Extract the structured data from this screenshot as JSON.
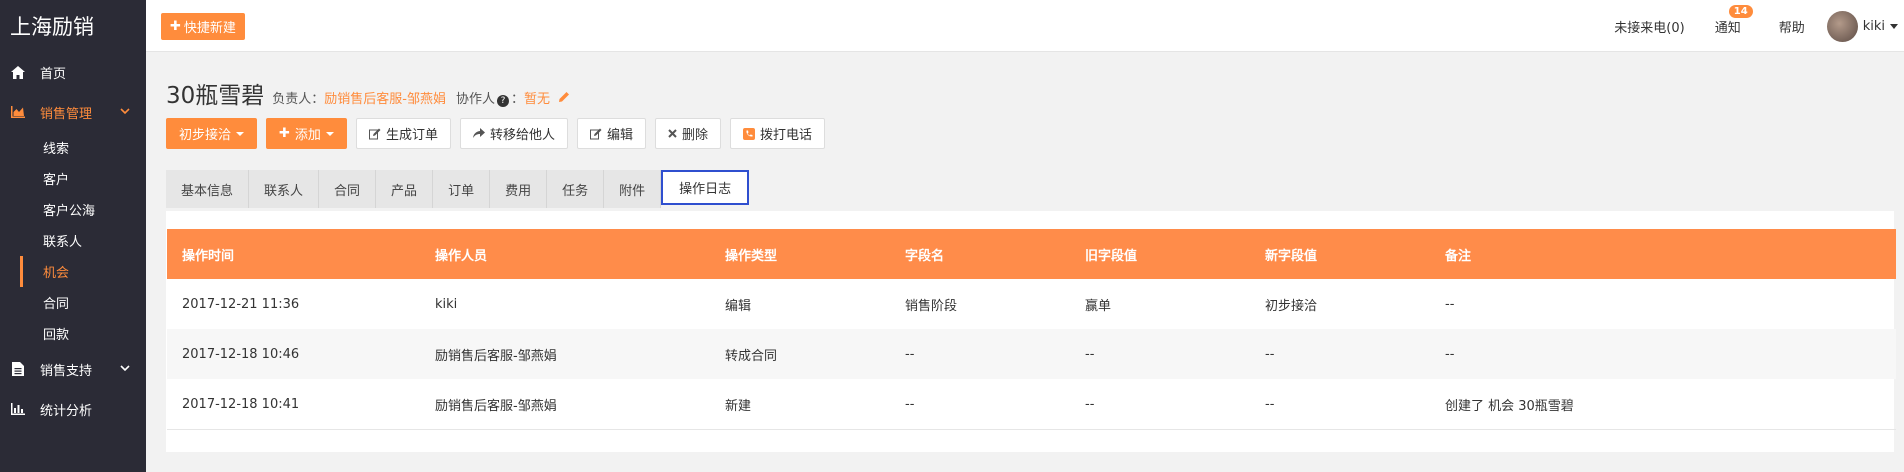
{
  "brand": "上海励销",
  "sidebar": {
    "items": [
      {
        "label": "首页",
        "icon": "home-icon"
      },
      {
        "label": "销售管理",
        "icon": "chart-area-icon"
      },
      {
        "label": "销售支持",
        "icon": "document-icon"
      },
      {
        "label": "统计分析",
        "icon": "bar-chart-icon"
      }
    ],
    "sub_items": [
      {
        "label": "线索"
      },
      {
        "label": "客户"
      },
      {
        "label": "客户公海"
      },
      {
        "label": "联系人"
      },
      {
        "label": "机会"
      },
      {
        "label": "合同"
      },
      {
        "label": "回款"
      }
    ]
  },
  "topbar": {
    "quick_new": "快捷新建",
    "missed_calls": "未接来电(0)",
    "notify": "通知",
    "notify_badge": "14",
    "help": "帮助",
    "user": "kiki"
  },
  "header": {
    "title": "30瓶雪碧",
    "owner_label": "负责人：",
    "owner": "励销售后客服-邹燕娟",
    "collab_label": "协作人",
    "collab_help": "?",
    "collab_colon": "：",
    "collab_value": "暂无"
  },
  "actions": {
    "stage": "初步接洽",
    "add": "添加",
    "gen_order": "生成订单",
    "transfer": "转移给他人",
    "edit": "编辑",
    "delete": "删除",
    "call": "拨打电话"
  },
  "tabs": [
    "基本信息",
    "联系人",
    "合同",
    "产品",
    "订单",
    "费用",
    "任务",
    "附件",
    "操作日志"
  ],
  "log_table": {
    "headers": [
      "操作时间",
      "操作人员",
      "操作类型",
      "字段名",
      "旧字段值",
      "新字段值",
      "备注"
    ],
    "rows": [
      [
        "2017-12-21 11:36",
        "kiki",
        "编辑",
        "销售阶段",
        "赢单",
        "初步接洽",
        "--"
      ],
      [
        "2017-12-18 10:46",
        "励销售后客服-邹燕娟",
        "转成合同",
        "--",
        "--",
        "--",
        "--"
      ],
      [
        "2017-12-18 10:41",
        "励销售后客服-邹燕娟",
        "新建",
        "--",
        "--",
        "--",
        "创建了 机会 30瓶雪碧"
      ]
    ]
  },
  "colors": {
    "accent": "#ff8c3c",
    "sidebar_bg": "#2b2b36",
    "tab_active_border": "#2f4fcf"
  }
}
